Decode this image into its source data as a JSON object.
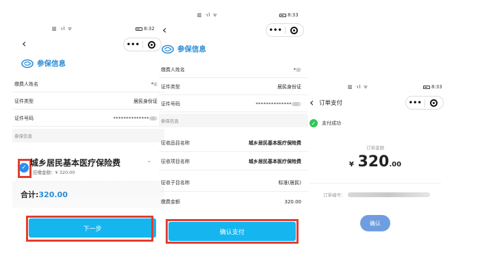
{
  "screen1": {
    "status_time": "8:32",
    "status_signal": "▥ ᐧıl ᯤ",
    "logo_label": "参保信息",
    "rows": [
      {
        "label": "缴费人姓名",
        "value": "*"
      },
      {
        "label": "证件类型",
        "value": "居民身份证"
      },
      {
        "label": "证件号码",
        "value": "**************"
      }
    ],
    "section_label": "参保信息",
    "insurance_title": "城乡居民基本医疗保险费",
    "fee_prefix": "应缴金额：",
    "fee_value": "¥ 320.00",
    "total_label": "合计:",
    "total_value": "320.00",
    "next_button": "下一步"
  },
  "screen2": {
    "status_time": "8:33",
    "status_signal": "▥ ᐧıl ᯤ",
    "logo_label": "参保信息",
    "rows": [
      {
        "label": "缴费人姓名",
        "value": "*"
      },
      {
        "label": "证件类型",
        "value": "居民身份证"
      },
      {
        "label": "证件号码",
        "value": "**************"
      }
    ],
    "section_label": "参保信息",
    "rows2": [
      {
        "label": "征收品目名称",
        "value": "城乡居民基本医疗保险费"
      },
      {
        "label": "征收项目名称",
        "value": "城乡居民基本医疗保险费"
      },
      {
        "label": "征收子目名称",
        "value": "标准(居民)"
      },
      {
        "label": "缴费金额",
        "value": "320.00"
      }
    ],
    "confirm_button": "确认支付"
  },
  "screen3": {
    "status_time": "8:33",
    "status_signal": "▥ ᐧıl ᯤ",
    "title": "订单支付",
    "success_label": "支付成功",
    "amount_label": "订单金额",
    "currency": "¥",
    "amount_int": "320",
    "amount_dec": ".00",
    "order_no_label": "订单编号：",
    "confirm_button": "确认"
  },
  "colors": {
    "primary": "#15b6f0",
    "link": "#2b8bd6",
    "highlight_box": "#e23d2f",
    "success": "#31c55a",
    "secondary_button": "#6f9ee0"
  },
  "icons": [
    "back-icon",
    "more-dots-icon",
    "close-target-icon",
    "insurance-logo-icon",
    "checked-icon",
    "chevron-down-icon",
    "success-icon"
  ]
}
